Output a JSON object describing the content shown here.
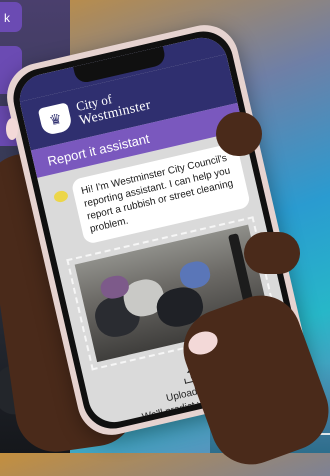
{
  "background": {
    "chip_text": "k"
  },
  "app": {
    "brand_line1": "City of",
    "brand_line2": "Westminster",
    "section_title": "Report it assistant",
    "bot_message": "Hi! I'm Westminster City Council's reporting assistant. I can help you report a rubbish or street cleaning problem.",
    "upload_label": "Upload photo",
    "upload_sublabel": "We'll predict your problem"
  },
  "icons": {
    "crest": "council-crest-icon",
    "bot": "chat-bubble-icon",
    "upload": "upload-icon"
  },
  "colors": {
    "header": "#2f2f6f",
    "section_bar": "#7a58be",
    "bot_icon": "#ecd64a",
    "screen_bg": "#dadada"
  }
}
